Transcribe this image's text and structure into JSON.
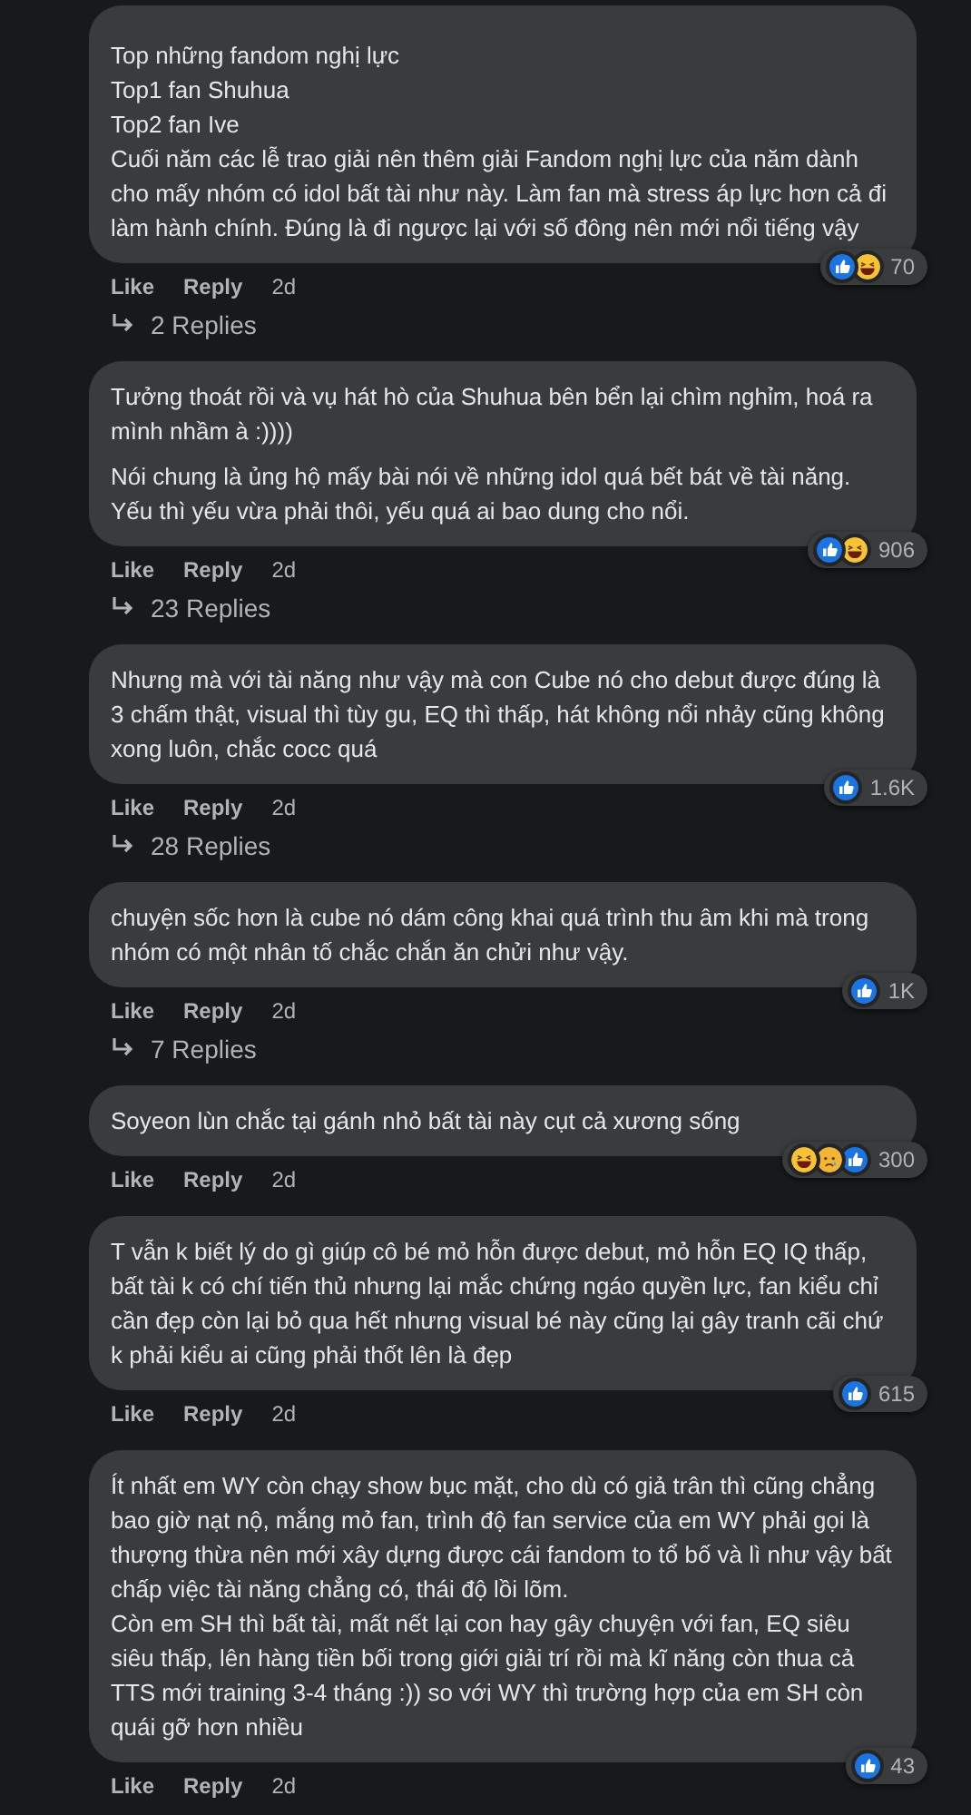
{
  "comments": [
    {
      "paragraphs": [
        [
          "Top những fandom nghị lực",
          "Top1 fan Shuhua",
          "Top2 fan Ive",
          "Cuối năm các lễ trao giải nên thêm giải Fandom nghị lực của năm dành cho mấy nhóm có idol bất tài như này. Làm fan mà stress áp lực hơn cả đi làm hành chính. Đúng là đi ngược lại với số đông nên mới nổi tiếng vậy"
        ]
      ],
      "reactions": [
        {
          "kind": "like"
        },
        {
          "kind": "haha"
        }
      ],
      "count": "70",
      "like": "Like",
      "reply": "Reply",
      "time": "2d",
      "replies": "2 Replies"
    },
    {
      "paragraphs": [
        [
          "Tưởng thoát rồi và vụ hát hò của Shuhua bên bển lại chìm nghỉm, hoá ra mình nhầm à :))))"
        ],
        [
          "Nói chung là ủng hộ mấy bài nói về những idol quá bết bát về tài năng. Yếu thì yếu vừa phải thôi, yếu quá ai bao dung cho nổi."
        ]
      ],
      "reactions": [
        {
          "kind": "like"
        },
        {
          "kind": "haha"
        }
      ],
      "count": "906",
      "like": "Like",
      "reply": "Reply",
      "time": "2d",
      "replies": "23 Replies"
    },
    {
      "paragraphs": [
        [
          "Nhưng mà với tài năng như vậy mà con Cube nó cho debut được đúng là 3 chấm thật, visual thì tùy gu, EQ thì thấp, hát không nổi nhảy cũng không xong luôn, chắc cocc quá"
        ]
      ],
      "reactions": [
        {
          "kind": "like"
        }
      ],
      "count": "1.6K",
      "like": "Like",
      "reply": "Reply",
      "time": "2d",
      "replies": "28 Replies"
    },
    {
      "paragraphs": [
        [
          "chuyện sốc hơn là cube nó dám công khai quá trình thu âm khi mà trong nhóm có một nhân tố chắc chắn ăn chửi như vậy."
        ]
      ],
      "reactions": [
        {
          "kind": "like"
        }
      ],
      "count": "1K",
      "like": "Like",
      "reply": "Reply",
      "time": "2d",
      "replies": "7 Replies"
    },
    {
      "paragraphs": [
        [
          "Soyeon lùn chắc tại gánh nhỏ bất tài này cụt cả xương sống"
        ]
      ],
      "reactions": [
        {
          "kind": "haha"
        },
        {
          "kind": "sad"
        },
        {
          "kind": "like"
        }
      ],
      "count": "300",
      "like": "Like",
      "reply": "Reply",
      "time": "2d"
    },
    {
      "paragraphs": [
        [
          "T vẫn k biết lý do gì giúp cô bé mỏ hỗn được debut, mỏ hỗn EQ IQ thấp, bất tài k có chí tiến thủ nhưng lại mắc chứng ngáo quyền lực, fan kiểu chỉ cần đẹp còn lại bỏ qua hết nhưng visual bé này cũng lại gây tranh cãi chứ k phải kiểu ai cũng phải thốt lên là đẹp"
        ]
      ],
      "reactions": [
        {
          "kind": "like"
        }
      ],
      "count": "615",
      "like": "Like",
      "reply": "Reply",
      "time": "2d"
    },
    {
      "paragraphs": [
        [
          "Ít nhất em WY còn chạy show bục mặt, cho dù có giả trân thì cũng chẳng bao giờ nạt nộ, mắng mỏ fan, trình độ fan service của em WY phải gọi là thượng thừa nên mới xây dựng được cái fandom to tổ bố và lì như vậy bất chấp việc tài năng chẳng có, thái độ lồi lõm.",
          "Còn em SH thì bất tài, mất nết lại con hay gây chuyện với fan, EQ siêu siêu thấp, lên hàng tiền bối trong giới giải trí rồi mà kĩ năng còn thua cả TTS mới training 3-4 tháng :)) so với WY thì trường hợp của em SH còn quái gỡ hơn nhiều"
        ]
      ],
      "reactions": [
        {
          "kind": "like"
        }
      ],
      "count": "43",
      "like": "Like",
      "reply": "Reply",
      "time": "2d"
    }
  ]
}
